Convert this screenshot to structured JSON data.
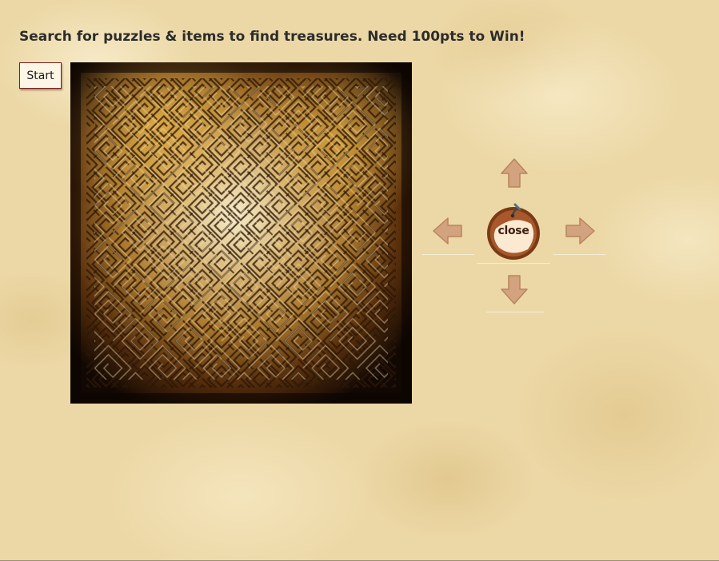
{
  "header": {
    "instructions": "Search for puzzles & items to find treasures. Need 100pts to Win!"
  },
  "controls": {
    "start_label": "Start",
    "close_label": "close"
  },
  "board": {
    "image": "maze-map-image"
  },
  "navigation": {
    "up": "arrow-up-icon",
    "left": "arrow-left-icon",
    "right": "arrow-right-icon",
    "down": "arrow-down-icon"
  },
  "colors": {
    "parchment": "#ecd8a6",
    "arrow": "#d3a27e",
    "close_ring": "#7a3a16",
    "button_border": "#7a1f1f"
  }
}
